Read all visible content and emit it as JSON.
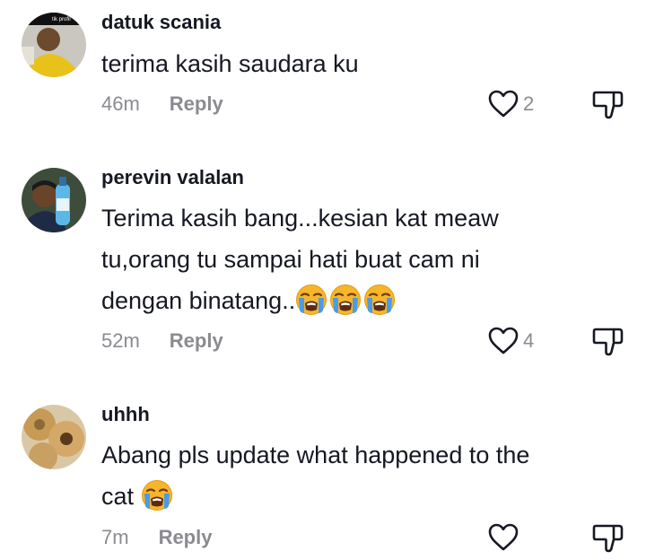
{
  "comments": [
    {
      "username": "datuk scania",
      "avatar_tag": "tik profil",
      "text": "terima kasih saudara ku",
      "time": "46m",
      "reply_label": "Reply",
      "likes": "2",
      "emoji_count": 0
    },
    {
      "username": "perevin valalan",
      "text_line1": "Terima kasih bang...kesian kat meaw",
      "text_line2": "tu,orang tu sampai hati buat cam ni",
      "text_line3": "dengan binatang..",
      "time": "52m",
      "reply_label": "Reply",
      "likes": "4",
      "emoji_count": 3
    },
    {
      "username": "uhhh",
      "text_line1": "Abang pls update what happened to the",
      "text_line2": "cat",
      "time": "7m",
      "reply_label": "Reply",
      "likes": "",
      "emoji_count": 1
    }
  ],
  "icons": {
    "like": "heart-outline-icon",
    "dislike": "thumbs-down-outline-icon",
    "emoji": "loudly-crying-face-emoji"
  },
  "colors": {
    "text": "#161823",
    "meta": "#8a8b91",
    "icon": "#161823",
    "emoji_face": "#F7B52C",
    "emoji_tears": "#4A9BE8"
  }
}
